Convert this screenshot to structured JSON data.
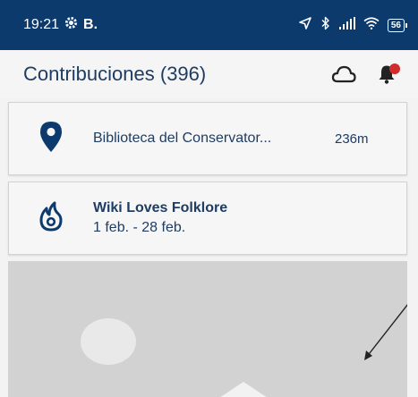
{
  "status_bar": {
    "time": "19:21",
    "carrier_label": "B.",
    "battery_level": "56",
    "icons": [
      "settings-cog-icon",
      "location-arrow-icon",
      "bluetooth-icon",
      "signal-icon",
      "wifi-icon",
      "battery-icon"
    ]
  },
  "app_bar": {
    "title": "Contribuciones (396)",
    "icons": [
      "cloud-upload-icon",
      "notification-bell-icon"
    ],
    "notification_dot_color": "#d12b2b"
  },
  "nearby_card": {
    "name": "Biblioteca del Conservator...",
    "distance": "236m",
    "icon": "map-pin-icon"
  },
  "campaign_card": {
    "title": "Wiki Loves Folklore",
    "dates": "1 feb. - 28 feb.",
    "icon": "campaign-flame-icon"
  },
  "colors": {
    "status_bar_bg": "#0d3a6d",
    "text_primary": "#1f3c63",
    "placeholder_bg": "#d2d2d2"
  }
}
